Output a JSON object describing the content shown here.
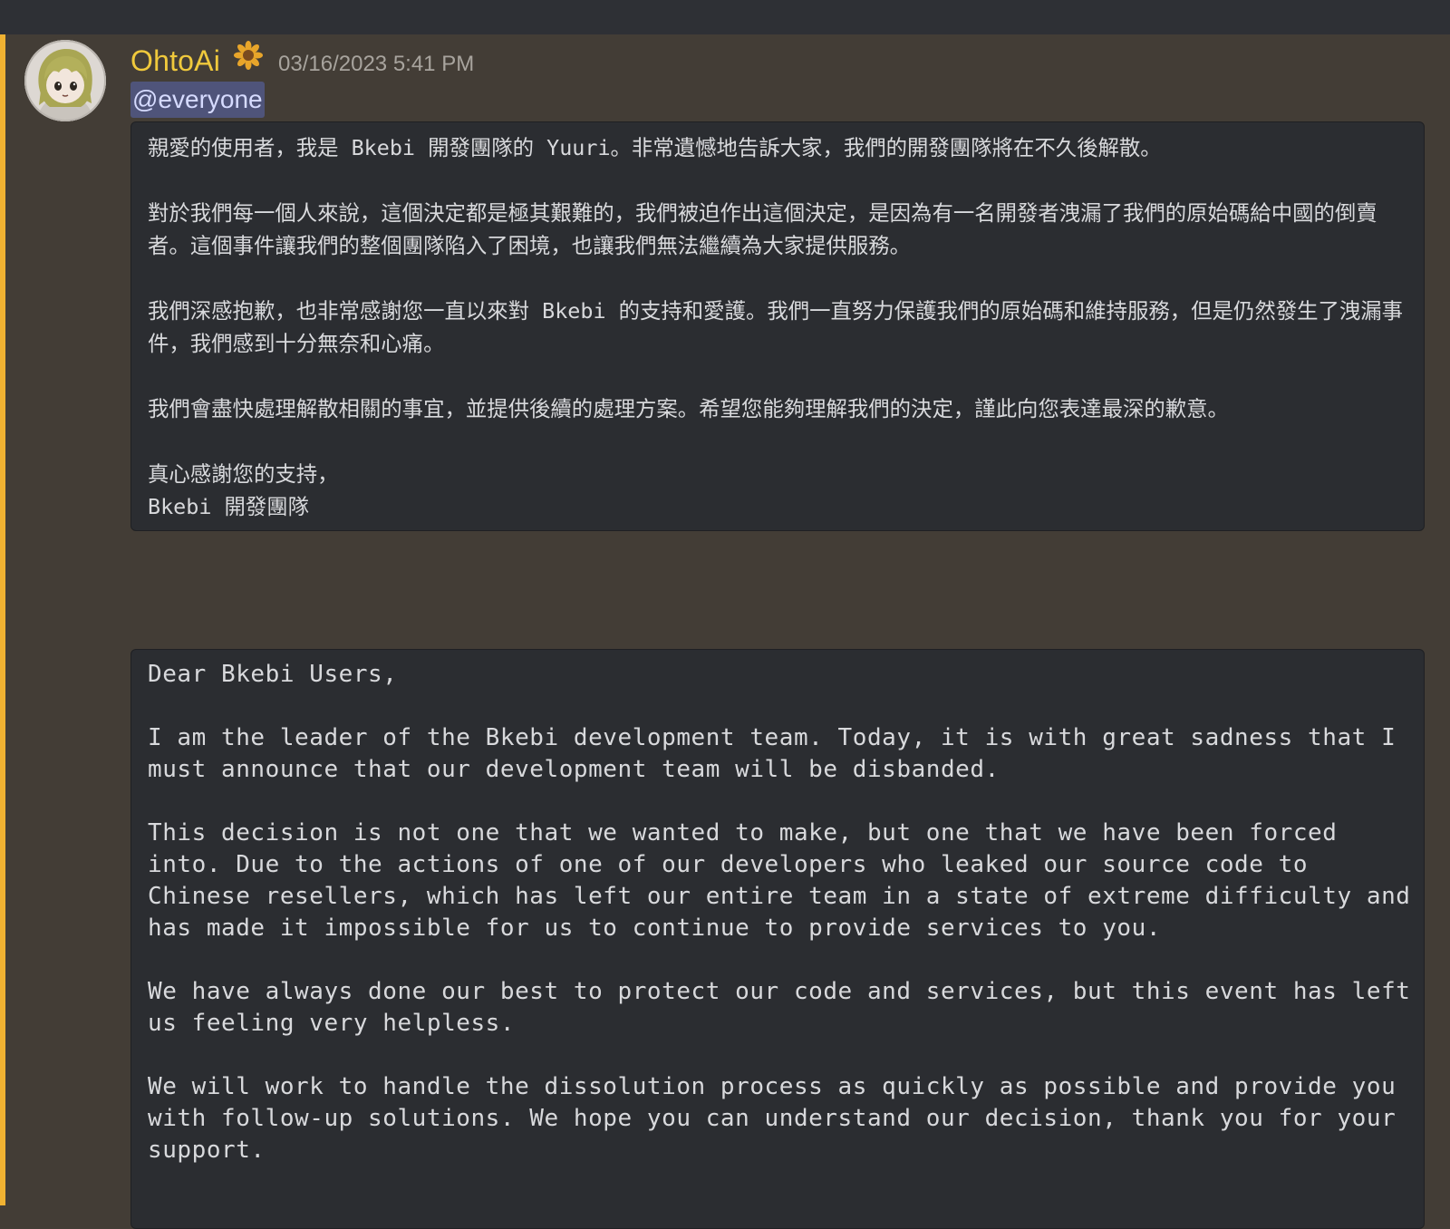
{
  "message": {
    "author": {
      "name": "OhtoAi",
      "badge_icon": "sunflower-icon",
      "name_color": "#f0c93c"
    },
    "timestamp": "03/16/2023 5:41 PM",
    "mention": "@everyone",
    "chinese_block": {
      "paragraphs": [
        "親愛的使用者，我是 Bkebi 開發團隊的 Yuuri。非常遺憾地告訴大家，我們的開發團隊將在不久後解散。",
        "對於我們每一個人來說，這個決定都是極其艱難的，我們被迫作出這個決定，是因為有一名開發者洩漏了我們的原始碼給中國的倒賣者。這個事件讓我們的整個團隊陷入了困境，也讓我們無法繼續為大家提供服務。",
        "我們深感抱歉，也非常感謝您一直以來對 Bkebi 的支持和愛護。我們一直努力保護我們的原始碼和維持服務，但是仍然發生了洩漏事件，我們感到十分無奈和心痛。",
        "我們會盡快處理解散相關的事宜，並提供後續的處理方案。希望您能夠理解我們的決定，謹此向您表達最深的歉意。",
        "真心感謝您的支持，\nBkebi 開發團隊"
      ]
    },
    "english_block": {
      "paragraphs": [
        "Dear Bkebi Users,",
        "I am the leader of the Bkebi development team. Today, it is with great sadness that I must announce that our development team will be disbanded.",
        "This decision is not one that we wanted to make, but one that we have been forced into. Due to the actions of one of our developers who leaked our source code to Chinese resellers, which has left our entire team in a state of extreme difficulty and has made it impossible for us to continue to provide services to you.",
        "We have always done our best to protect our code and services, but this event has left us feeling very helpless.",
        "We will work to handle the dissolution process as quickly as possible and provide you with follow-up solutions. We hope you can understand our decision, thank you for your support."
      ]
    }
  },
  "colors": {
    "background": "#433d36",
    "topbar": "#2e3035",
    "codeblock": "#2b2d31",
    "mention_bar": "#f0b232",
    "mention_bg": "#4f547a",
    "text": "#d8d9dc",
    "timestamp": "#a8a49e"
  }
}
